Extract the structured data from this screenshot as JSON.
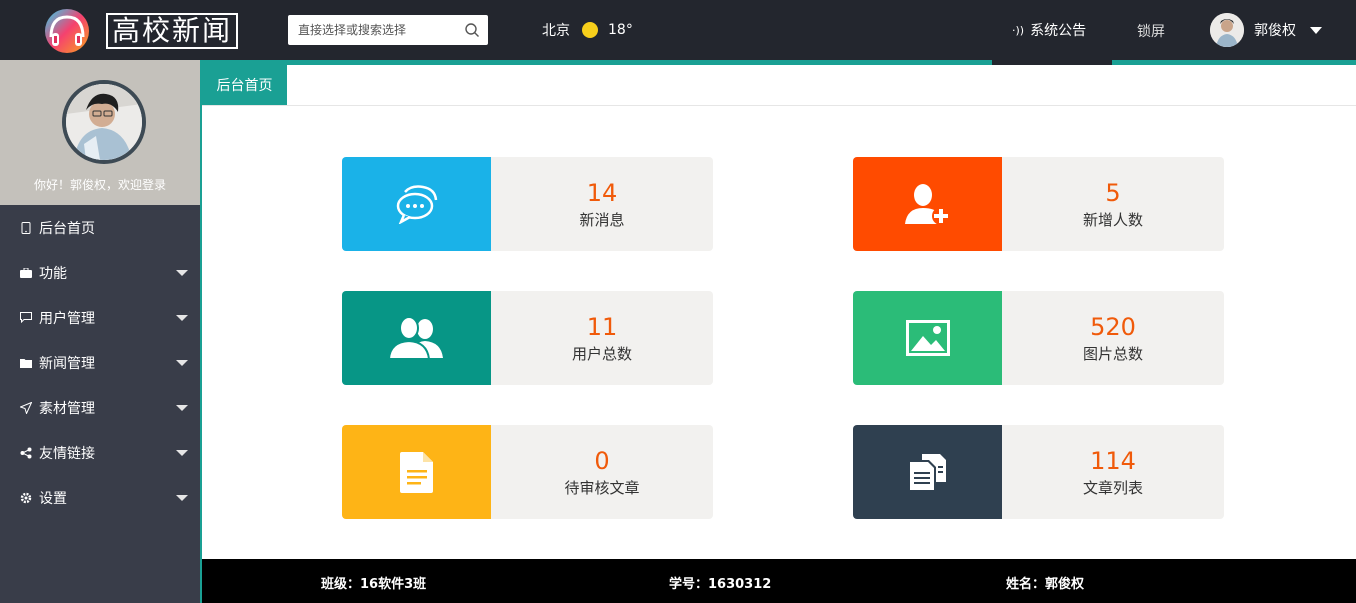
{
  "header": {
    "logo_text": "高校新闻",
    "search_placeholder": "直接选择或搜索选择",
    "weather_city": "北京",
    "weather_temp": "18°",
    "notice_label": "系统公告",
    "lock_label": "锁屏",
    "username": "郭俊权"
  },
  "sidebar": {
    "welcome": "你好！郭俊权，欢迎登录",
    "items": [
      {
        "label": "后台首页",
        "icon": "tablet-icon",
        "has_arrow": false
      },
      {
        "label": "功能",
        "icon": "briefcase-icon",
        "has_arrow": true
      },
      {
        "label": "用户管理",
        "icon": "message-icon",
        "has_arrow": true
      },
      {
        "label": "新闻管理",
        "icon": "folder-icon",
        "has_arrow": true
      },
      {
        "label": "素材管理",
        "icon": "paper-plane-icon",
        "has_arrow": true
      },
      {
        "label": "友情链接",
        "icon": "share-icon",
        "has_arrow": true
      },
      {
        "label": "设置",
        "icon": "gear-icon",
        "has_arrow": true
      }
    ]
  },
  "tabs": {
    "active": "后台首页"
  },
  "cards": [
    {
      "value": "14",
      "label": "新消息",
      "color": "#1ab2e8",
      "icon": "chat-bubble-icon"
    },
    {
      "value": "5",
      "label": "新增人数",
      "color": "#ff4b00",
      "icon": "add-user-icon"
    },
    {
      "value": "11",
      "label": "用户总数",
      "color": "#079686",
      "icon": "users-icon"
    },
    {
      "value": "520",
      "label": "图片总数",
      "color": "#2bbc78",
      "icon": "image-icon"
    },
    {
      "value": "0",
      "label": "待审核文章",
      "color": "#feb416",
      "icon": "document-icon"
    },
    {
      "value": "114",
      "label": "文章列表",
      "color": "#2f4050",
      "icon": "articles-icon"
    }
  ],
  "footer": {
    "class_info": "班级：16软件3班",
    "student_id": "学号：1630312",
    "name": "姓名：郭俊权"
  },
  "colors": {
    "topbar": "#23262e",
    "sidebar": "#393d49",
    "accent": "#1aa094",
    "number": "#f05a0a"
  }
}
